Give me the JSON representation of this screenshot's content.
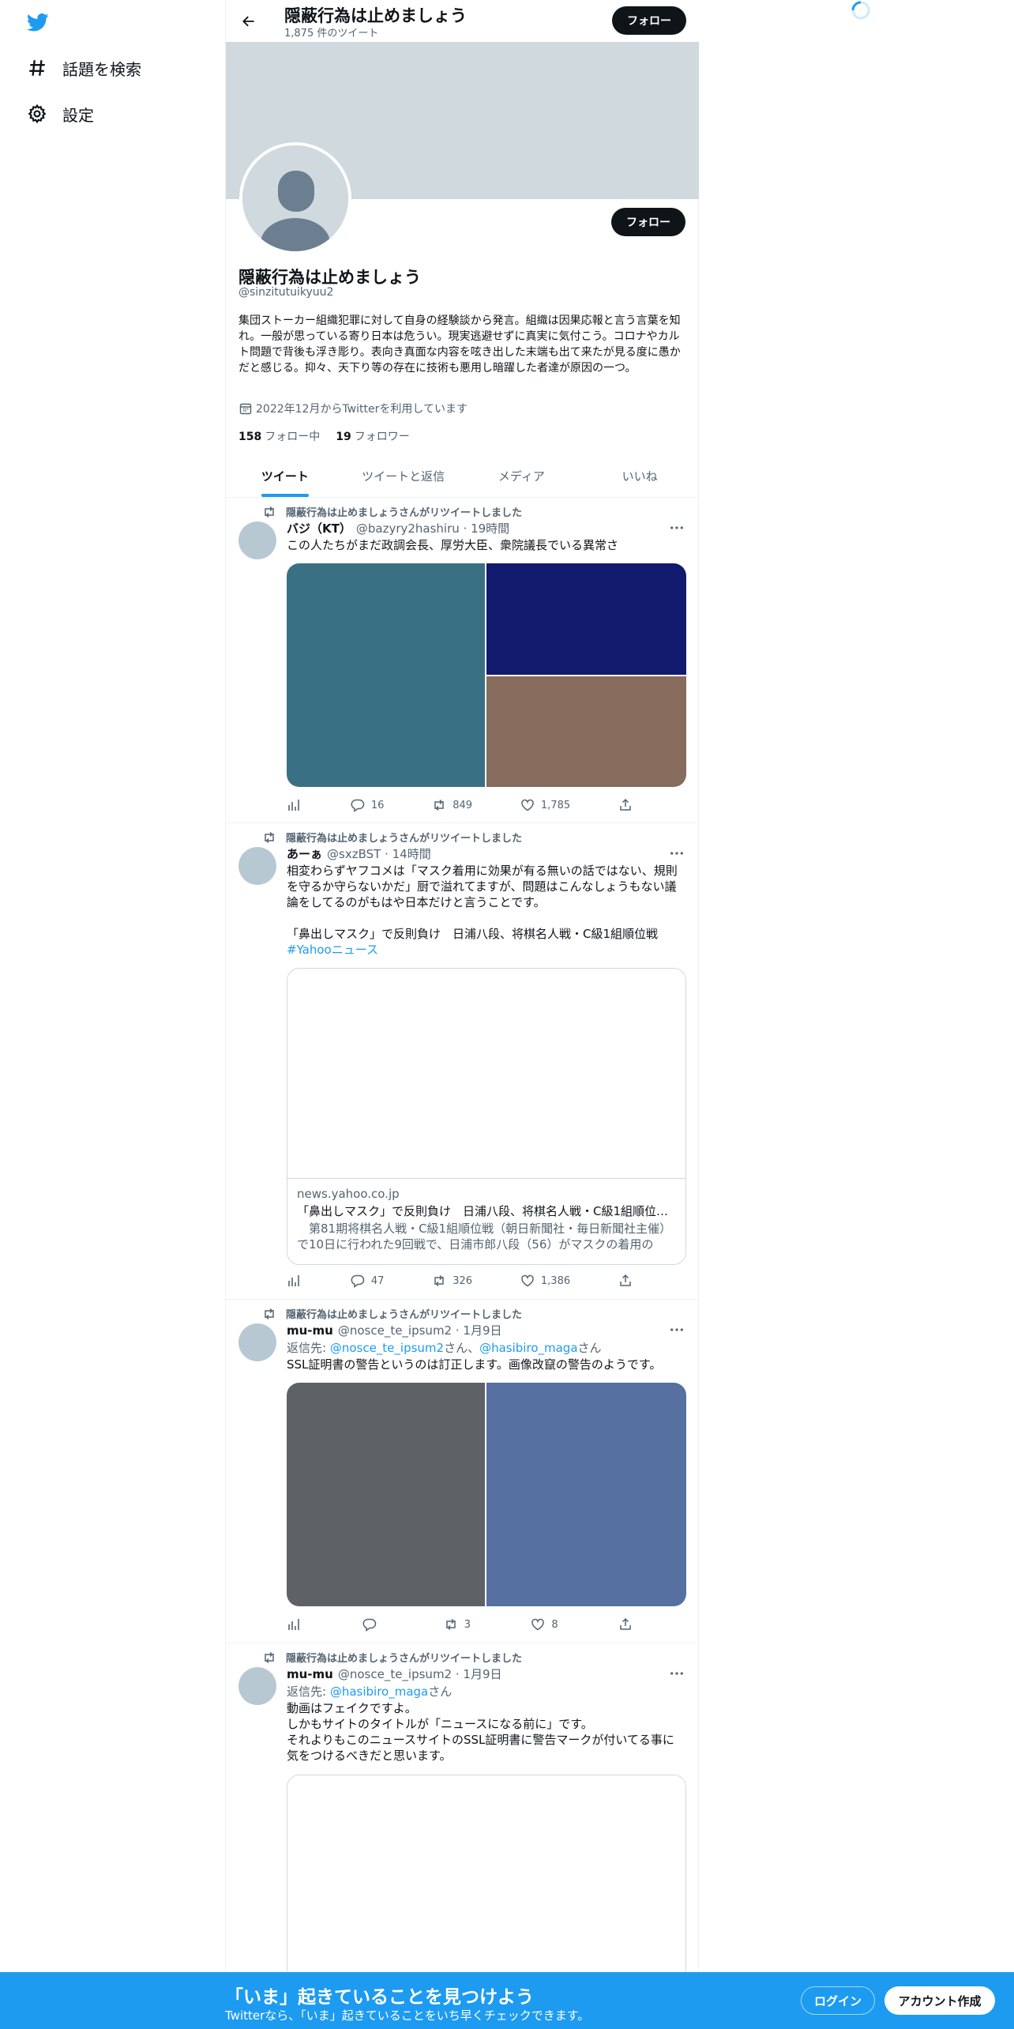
{
  "sidebar": {
    "items": [
      {
        "label": "話題を検索",
        "icon": "hashtag-icon"
      },
      {
        "label": "設定",
        "icon": "gear-icon"
      }
    ]
  },
  "header": {
    "title": "隠蔽行為は止めましょう",
    "tweet_count": "1,875 件のツイート",
    "follow_label": "フォロー"
  },
  "profile": {
    "name": "隠蔽行為は止めましょう",
    "handle": "@sinzitutuikyuu2",
    "bio": "集団ストーカー組織犯罪に対して自身の経験談から発言。組織は因果応報と言う言葉を知れ。一般が思っている寄り日本は危うい。現実逃避せずに真実に気付こう。コロナやカルト問題で背後も浮き彫り。表向き真面な内容を呟き出した末端も出て来たが見る度に愚かだと感じる。抑々、天下り等の存在に技術も悪用し暗躍した者達が原因の一つ。",
    "joined": "2022年12月からTwitterを利用しています",
    "following_count": "158",
    "following_label": "フォロー中",
    "followers_count": "19",
    "followers_label": "フォロワー",
    "follow_label": "フォロー"
  },
  "tabs": [
    {
      "label": "ツイート",
      "active": true
    },
    {
      "label": "ツイートと返信",
      "active": false
    },
    {
      "label": "メディア",
      "active": false
    },
    {
      "label": "いいね",
      "active": false
    }
  ],
  "retweet_label": "隠蔽行為は止めましょうさんがリツイートしました",
  "tweets": [
    {
      "name": "バジ（KT）",
      "handle": "@bazyry2hashiru",
      "time": "· 19時間",
      "text": "この人たちがまだ政調会長、厚労大臣、衆院議長でいる異常さ",
      "media_colors": [
        "#3a7083",
        "#121a6e",
        "#876b5c"
      ],
      "replies": "16",
      "retweets": "849",
      "likes": "1,785"
    },
    {
      "name": "あーぁ",
      "handle": "@sxzBST",
      "time": "· 14時間",
      "text_lines": [
        "相変わらずヤフコメは「マスク着用に効果が有る無いの話ではない、規則を守るか守らないかだ」厨で溢れてますが、問題はこんなしょうもない議論をしてるのがもはや日本だけと言うことです。",
        "「鼻出しマスク」で反則負け　日浦八段、将棋名人戦・C級1組順位戦"
      ],
      "hashtag": "#Yahooニュース",
      "card": {
        "domain": "news.yahoo.co.jp",
        "title": "「鼻出しマスク」で反則負け　日浦八段、将棋名人戦・C級1組順位戦...",
        "desc": "　第81期将棋名人戦・C級1組順位戦（朝日新聞社・毎日新聞社主催）で10日に行われた9回戦で、日浦市郎八段（56）がマスクの着用の仕..."
      },
      "replies": "47",
      "retweets": "326",
      "likes": "1,386"
    },
    {
      "name": "mu-mu",
      "handle": "@nosce_te_ipsum2",
      "time": "· 1月9日",
      "reply_prefix": "返信先: ",
      "reply_to_1": "@nosce_te_ipsum2",
      "reply_mid": "さん、",
      "reply_to_2": "@hasibiro_maga",
      "reply_suffix": "さん",
      "text": "SSL証明書の警告というのは訂正します。画像改竄の警告のようです。",
      "media_colors": [
        "#5e6166",
        "#5670a1"
      ],
      "replies": "",
      "retweets": "3",
      "likes": "8"
    },
    {
      "name": "mu-mu",
      "handle": "@nosce_te_ipsum2",
      "time": "· 1月9日",
      "reply_prefix": "返信先: ",
      "reply_to_1": "@hasibiro_maga",
      "reply_suffix": "さん",
      "text_lines": [
        "動画はフェイクですよ。",
        "しかもサイトのタイトルが「ニュースになる前に」です。",
        "それよりもこのニュースサイトのSSL証明書に警告マークが付いてる事に気をつけるべきだと思います。"
      ]
    }
  ],
  "bottom_bar": {
    "title": "「いま」起きていることを見つけよう",
    "subtitle": "Twitterなら、「いま」起きていることをいち早くチェックできます。",
    "login_label": "ログイン",
    "signup_label": "アカウント作成"
  },
  "colors": {
    "brand": "#1d9bf0",
    "dark": "#0f1419",
    "muted": "#536471"
  }
}
